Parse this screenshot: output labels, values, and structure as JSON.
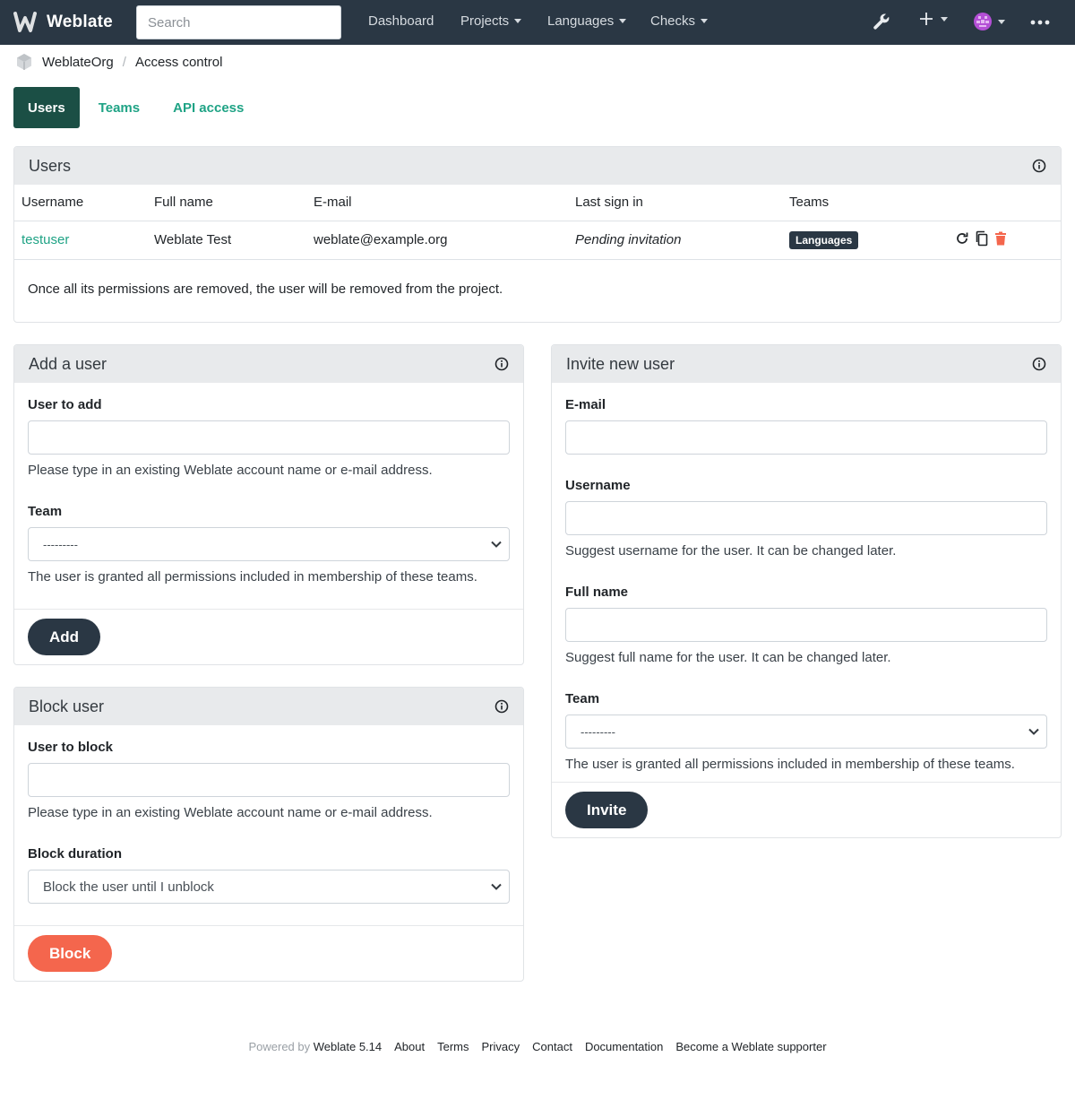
{
  "nav": {
    "brand": "Weblate",
    "search_placeholder": "Search",
    "dashboard": "Dashboard",
    "projects": "Projects",
    "languages": "Languages",
    "checks": "Checks"
  },
  "breadcrumb": {
    "org": "WeblateOrg",
    "page": "Access control"
  },
  "tabs": {
    "users": "Users",
    "teams": "Teams",
    "api": "API access"
  },
  "users_card": {
    "title": "Users",
    "columns": [
      "Username",
      "Full name",
      "E-mail",
      "Last sign in",
      "Teams"
    ],
    "row": {
      "username": "testuser",
      "full_name": "Weblate Test",
      "email": "weblate@example.org",
      "last_sign_in": "Pending invitation",
      "team": "Languages"
    },
    "note": "Once all its permissions are removed, the user will be removed from the project."
  },
  "add_user": {
    "title": "Add a user",
    "user_label": "User to add",
    "user_help": "Please type in an existing Weblate account name or e-mail address.",
    "team_label": "Team",
    "team_value": "---------",
    "team_help": "The user is granted all permissions included in membership of these teams.",
    "button": "Add"
  },
  "block_user": {
    "title": "Block user",
    "user_label": "User to block",
    "user_help": "Please type in an existing Weblate account name or e-mail address.",
    "duration_label": "Block duration",
    "duration_value": "Block the user until I unblock",
    "button": "Block"
  },
  "invite": {
    "title": "Invite new user",
    "email_label": "E-mail",
    "username_label": "Username",
    "username_help": "Suggest username for the user. It can be changed later.",
    "fullname_label": "Full name",
    "fullname_help": "Suggest full name for the user. It can be changed later.",
    "team_label": "Team",
    "team_value": "---------",
    "team_help": "The user is granted all permissions included in membership of these teams.",
    "button": "Invite"
  },
  "footer": {
    "powered_by": "Powered by",
    "version": "Weblate 5.14",
    "about": "About",
    "terms": "Terms",
    "privacy": "Privacy",
    "contact": "Contact",
    "documentation": "Documentation",
    "supporter": "Become a Weblate supporter"
  },
  "colors": {
    "navbar": "#2a3744",
    "accent": "#1fa385",
    "active_tab": "#1b4f45",
    "danger": "#f4664d"
  }
}
